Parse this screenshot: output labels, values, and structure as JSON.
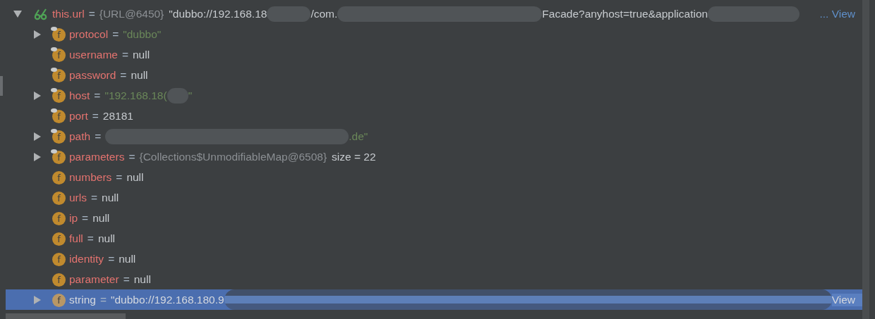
{
  "root": {
    "name": "this.url",
    "separator": "=",
    "expanded": true,
    "watch": true,
    "segments": [
      {
        "kind": "type",
        "text": "{URL@6450}"
      },
      {
        "kind": "plain",
        "text": "\"dubbo://192.168.18"
      },
      {
        "kind": "redaction"
      },
      {
        "kind": "plain",
        "text": "/com."
      },
      {
        "kind": "redaction"
      },
      {
        "kind": "plain",
        "text": "Facade?anyhost=true&application"
      },
      {
        "kind": "redaction"
      },
      {
        "kind": "link",
        "text": "... View"
      }
    ]
  },
  "children": [
    {
      "name": "protocol",
      "badge": "f",
      "final": true,
      "expandable": true,
      "selected": false,
      "segments": [
        {
          "kind": "string",
          "text": "\"dubbo\""
        }
      ]
    },
    {
      "name": "username",
      "badge": "f",
      "final": true,
      "expandable": false,
      "selected": false,
      "segments": [
        {
          "kind": "plain",
          "text": "null"
        }
      ]
    },
    {
      "name": "password",
      "badge": "f",
      "final": true,
      "expandable": false,
      "selected": false,
      "segments": [
        {
          "kind": "plain",
          "text": "null"
        }
      ]
    },
    {
      "name": "host",
      "badge": "f",
      "final": true,
      "expandable": true,
      "selected": false,
      "segments": [
        {
          "kind": "string",
          "text": "\"192.168.18("
        },
        {
          "kind": "redaction"
        },
        {
          "kind": "string",
          "text": "\""
        }
      ]
    },
    {
      "name": "port",
      "badge": "f",
      "final": true,
      "expandable": false,
      "selected": false,
      "segments": [
        {
          "kind": "plain",
          "text": "28181"
        }
      ]
    },
    {
      "name": "path",
      "badge": "f",
      "final": true,
      "expandable": true,
      "selected": false,
      "segments": [
        {
          "kind": "redaction"
        },
        {
          "kind": "string",
          "text": ".de\""
        }
      ]
    },
    {
      "name": "parameters",
      "badge": "f",
      "final": true,
      "expandable": true,
      "selected": false,
      "segments": [
        {
          "kind": "type",
          "text": "{Collections$UnmodifiableMap@6508}"
        },
        {
          "kind": "plain",
          "text": "size = 22"
        }
      ]
    },
    {
      "name": "numbers",
      "badge": "f",
      "final": false,
      "expandable": false,
      "selected": false,
      "segments": [
        {
          "kind": "plain",
          "text": "null"
        }
      ]
    },
    {
      "name": "urls",
      "badge": "f",
      "final": false,
      "expandable": false,
      "selected": false,
      "segments": [
        {
          "kind": "plain",
          "text": "null"
        }
      ]
    },
    {
      "name": "ip",
      "badge": "f",
      "final": false,
      "expandable": false,
      "selected": false,
      "segments": [
        {
          "kind": "plain",
          "text": "null"
        }
      ]
    },
    {
      "name": "full",
      "badge": "f",
      "final": false,
      "expandable": false,
      "selected": false,
      "segments": [
        {
          "kind": "plain",
          "text": "null"
        }
      ]
    },
    {
      "name": "identity",
      "badge": "f",
      "final": false,
      "expandable": false,
      "selected": false,
      "segments": [
        {
          "kind": "plain",
          "text": "null"
        }
      ]
    },
    {
      "name": "parameter",
      "badge": "f",
      "final": false,
      "expandable": false,
      "selected": false,
      "segments": [
        {
          "kind": "plain",
          "text": "null"
        }
      ]
    },
    {
      "name": "string",
      "badge": "f",
      "final": false,
      "expandable": true,
      "selected": true,
      "segments": [
        {
          "kind": "plain",
          "text": "\"dubbo://192.168.180.9"
        },
        {
          "kind": "redaction"
        },
        {
          "kind": "link",
          "text": "View"
        }
      ]
    }
  ]
}
